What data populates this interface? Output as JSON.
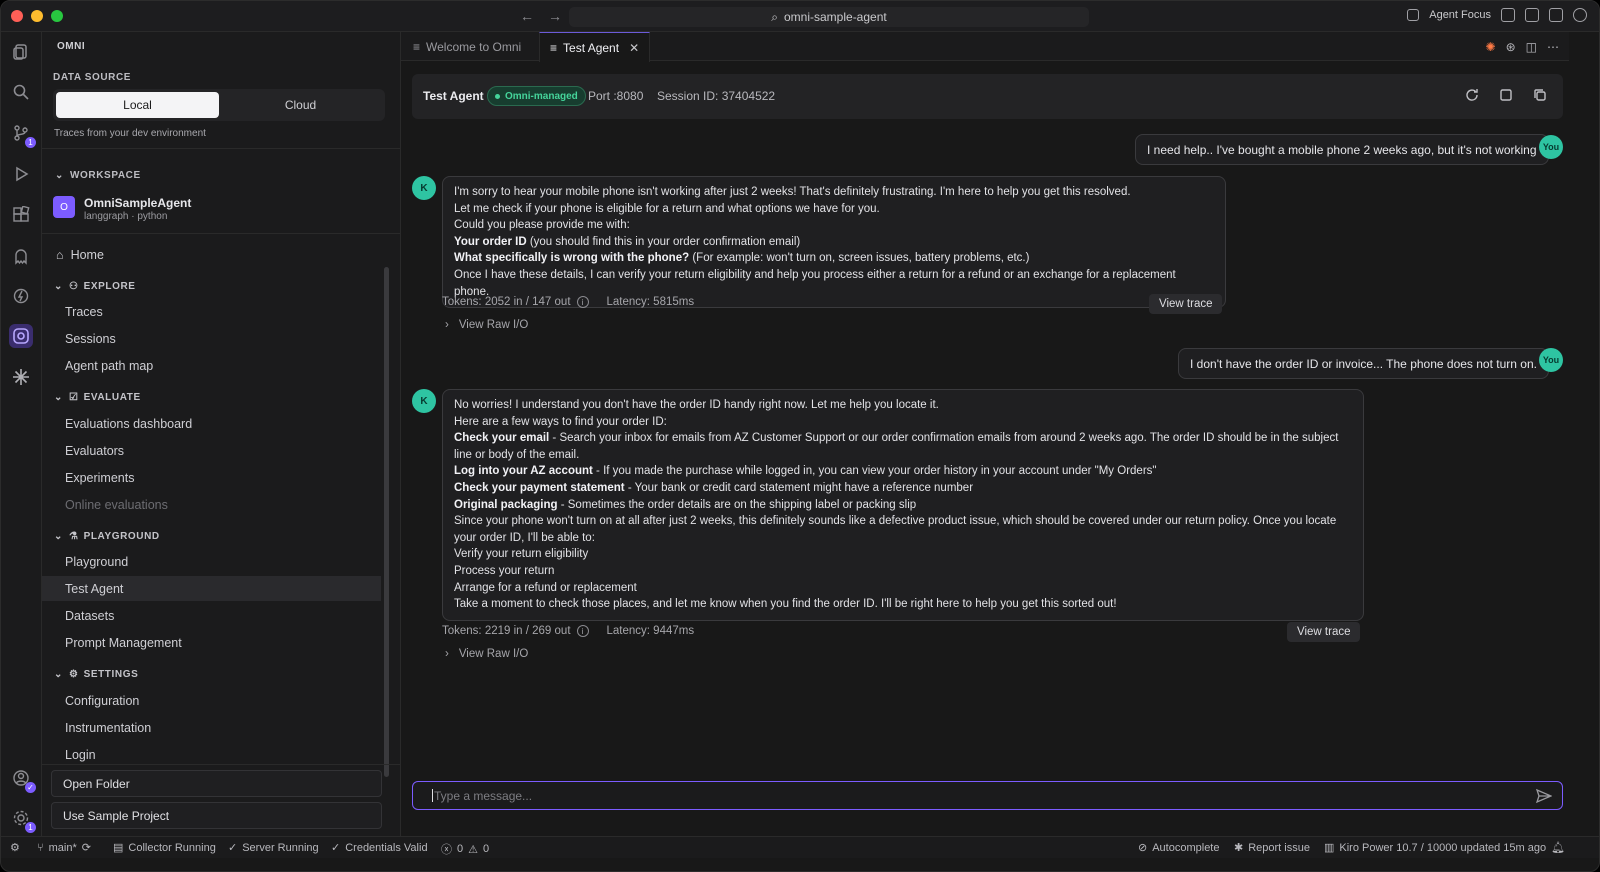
{
  "titlebar": {
    "search_label": "omni-sample-agent",
    "agent_focus": "Agent Focus",
    "traffic_colors": [
      "#ff5f57",
      "#febc2e",
      "#28c840"
    ]
  },
  "sidebar": {
    "title": "OMNI",
    "data_source": {
      "label": "DATA SOURCE",
      "options": [
        "Local",
        "Cloud"
      ],
      "selected": "Local",
      "subtitle": "Traces from your dev environment"
    },
    "workspace": {
      "label": "WORKSPACE",
      "avatar": "O",
      "name": "OmniSampleAgent",
      "meta": "langgraph · python"
    },
    "nav": {
      "home": "Home",
      "explore": "EXPLORE",
      "traces": "Traces",
      "sessions": "Sessions",
      "agent_path_map": "Agent path map",
      "evaluate": "EVALUATE",
      "evaluations_dashboard": "Evaluations dashboard",
      "evaluators": "Evaluators",
      "experiments": "Experiments",
      "online_evaluations": "Online evaluations",
      "playground_section": "PLAYGROUND",
      "playground": "Playground",
      "test_agent": "Test Agent",
      "datasets": "Datasets",
      "prompt_management": "Prompt Management",
      "settings": "SETTINGS",
      "configuration": "Configuration",
      "instrumentation": "Instrumentation",
      "login": "Login"
    },
    "buttons": {
      "open_folder": "Open Folder",
      "use_sample": "Use Sample Project"
    }
  },
  "activity_badges": {
    "source_control": "1",
    "settings": "1"
  },
  "tabs": [
    {
      "label": "Welcome to Omni"
    },
    {
      "label": "Test Agent"
    }
  ],
  "agent_header": {
    "title": "Test Agent",
    "badge": "Omni-managed",
    "port": "Port :8080",
    "session": "Session ID: 37404522"
  },
  "chat": {
    "user_label": "You",
    "bot_label": "K",
    "user1": "I need help.. I've bought a mobile phone 2 weeks ago, but it's not working",
    "bot1": {
      "l1": "I'm sorry to hear your mobile phone isn't working after just 2 weeks! That's definitely frustrating. I'm here to help you get this resolved.",
      "l2": "Let me check if your phone is eligible for a return and what options we have for you.",
      "l3": "Could you please provide me with:",
      "l4b": "Your order ID",
      "l4": " (you should find this in your order confirmation email)",
      "l5b": "What specifically is wrong with the phone?",
      "l5": " (For example: won't turn on, screen issues, battery problems, etc.)",
      "l6": "Once I have these details, I can verify your return eligibility and help you process either a return for a refund or an exchange for a replacement phone.",
      "tokens": "Tokens: 2052 in / 147 out",
      "latency": "Latency: 5815ms"
    },
    "user2": "I don't have the order ID or invoice... The phone does not turn on.",
    "bot2": {
      "l1": "No worries! I understand you don't have the order ID handy right now. Let me help you locate it.",
      "l2": "Here are a few ways to find your order ID:",
      "l3b": "Check your email",
      "l3": " - Search your inbox for emails from AZ Customer Support or our order confirmation emails from around 2 weeks ago. The order ID should be in the subject line or body of the email.",
      "l4b": "Log into your AZ account",
      "l4": " - If you made the purchase while logged in, you can view your order history in your account under \"My Orders\"",
      "l5b": "Check your payment statement",
      "l5": " - Your bank or credit card statement might have a reference number",
      "l6b": "Original packaging",
      "l6": " - Sometimes the order details are on the shipping label or packing slip",
      "l7": "Since your phone won't turn on at all after just 2 weeks, this definitely sounds like a defective product issue, which should be covered under our return policy. Once you locate your order ID, I'll be able to:",
      "l8": "Verify your return eligibility",
      "l9": "Process your return",
      "l10": "Arrange for a refund or replacement",
      "l11": "Take a moment to check those places, and let me know when you find the order ID. I'll be right here to help you get this sorted out!",
      "tokens": "Tokens: 2219 in / 269 out",
      "latency": "Latency: 9447ms"
    },
    "view_trace": "View trace",
    "view_raw": "View Raw I/O",
    "input_placeholder": "Type a message..."
  },
  "statusbar": {
    "branch": "main*",
    "collector": "Collector Running",
    "server": "Server Running",
    "credentials": "Credentials Valid",
    "errors": "0",
    "warnings": "0",
    "autocomplete": "Autocomplete",
    "report": "Report issue",
    "kiro": "Kiro Power 10.7 / 10000 updated 15m ago"
  },
  "colors": {
    "accent": "#7c5cff",
    "success": "#45d49a",
    "avatar": "#2ec4a2"
  }
}
